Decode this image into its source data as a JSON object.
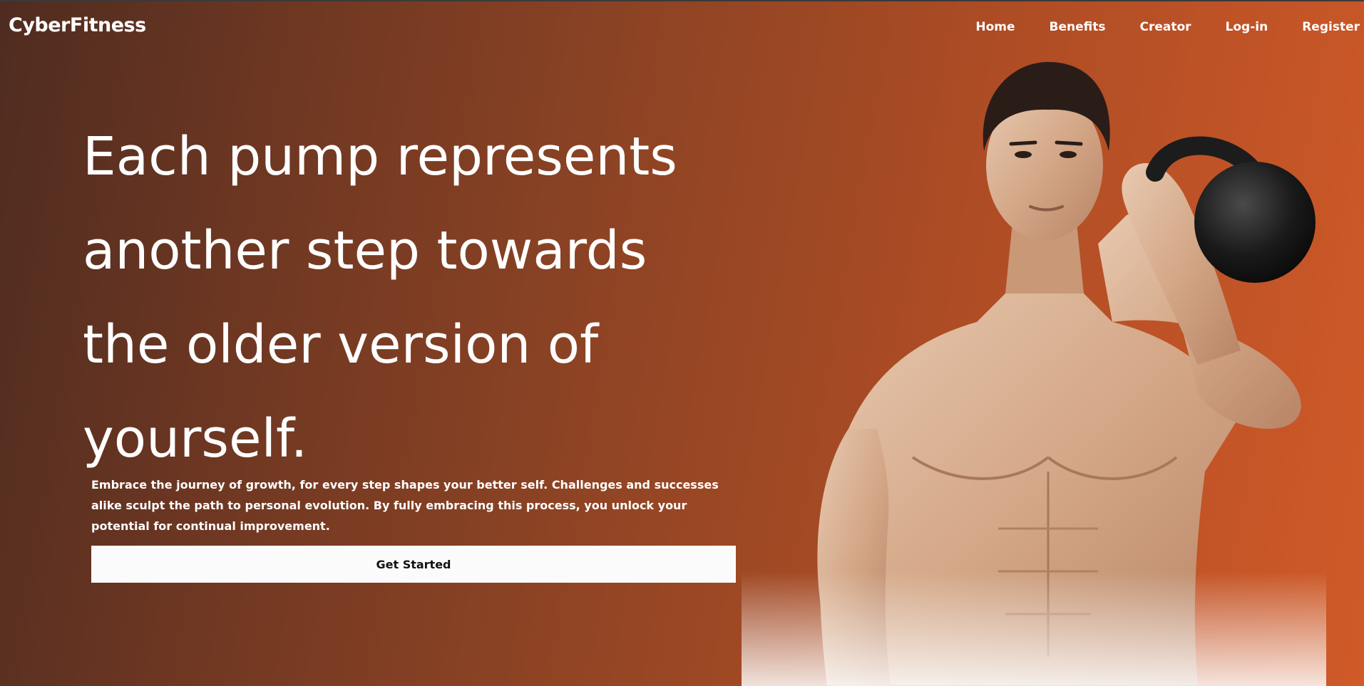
{
  "header": {
    "brand": "CyberFitness",
    "nav": [
      {
        "label": "Home"
      },
      {
        "label": "Benefits"
      },
      {
        "label": "Creator"
      },
      {
        "label": "Log-in"
      },
      {
        "label": "Register"
      }
    ]
  },
  "hero": {
    "headline_lines": [
      "Each pump represents",
      "another step towards",
      "the older version of",
      "yourself."
    ],
    "subtext": "Embrace the journey of growth, for every step shapes your better self. Challenges and successes alike sculpt the path to personal evolution. By fully embracing this process, you unlock your potential for continual improvement.",
    "cta_label": "Get Started"
  },
  "colors": {
    "gradient_start": "#4f2c20",
    "gradient_end": "#d05a28",
    "cta_background": "#fbfbfb",
    "text": "#ffffff"
  }
}
